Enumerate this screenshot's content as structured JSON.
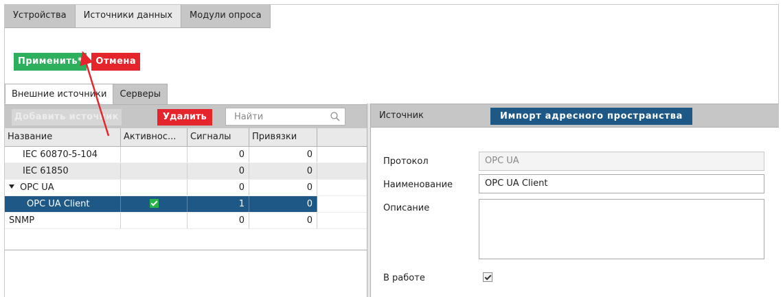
{
  "top_tabs": [
    {
      "label": "Устройства"
    },
    {
      "label": "Источники данных"
    },
    {
      "label": "Модули опроса"
    }
  ],
  "actions": {
    "apply_label": "Применить*",
    "cancel_label": "Отмена"
  },
  "sub_tabs": [
    {
      "label": "Внешние источники"
    },
    {
      "label": "Серверы"
    }
  ],
  "left_toolbar": {
    "add_label": "Добавить источник",
    "delete_label": "Удалить",
    "search_placeholder": "Найти"
  },
  "grid": {
    "columns": [
      "Название",
      "Активнос...",
      "Сигналы",
      "Привязки"
    ],
    "rows": [
      {
        "name": "IEC 60870-5-104",
        "active": false,
        "signals": "0",
        "bindings": "0"
      },
      {
        "name": "IEC 61850",
        "active": false,
        "signals": "0",
        "bindings": "0"
      },
      {
        "name": "OPC UA",
        "active": false,
        "signals": "0",
        "bindings": "0"
      },
      {
        "name": "OPC UA Client",
        "active": true,
        "signals": "1",
        "bindings": "0"
      },
      {
        "name": "SNMP",
        "active": false,
        "signals": "0",
        "bindings": "0"
      }
    ]
  },
  "right_panel": {
    "tab_label": "Источник",
    "import_label": "Импорт адресного пространства",
    "protocol_label": "Протокол",
    "protocol_value": "OPC UA",
    "name_label": "Наименование",
    "name_value": "OPC UA Client",
    "description_label": "Описание",
    "description_value": "",
    "in_work_label": "В работе",
    "in_work_checked": true
  },
  "colors": {
    "apply": "#2eaf5e",
    "danger": "#e5252c",
    "selection": "#1e5887",
    "active_check": "#27b24a",
    "annotation_arrow": "#e5252c"
  }
}
